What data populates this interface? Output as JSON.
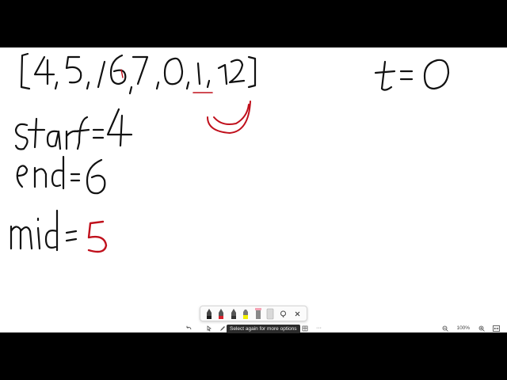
{
  "whiteboard": {
    "ink_colors": {
      "black": "#111111",
      "red": "#c0101c"
    },
    "handwriting": {
      "array": "[4,5,6,7,0,1,2]",
      "target": "t = 0",
      "start": "start = 4",
      "end": "end = 6",
      "mid": "mid = 5"
    }
  },
  "pen_toolbar": {
    "pens": [
      {
        "name": "black-pen",
        "color": "#1a1a1a"
      },
      {
        "name": "red-pen",
        "color": "#d8202c"
      },
      {
        "name": "dark-pen",
        "color": "#333333"
      },
      {
        "name": "highlighter-yellow",
        "color": "#f2f000"
      },
      {
        "name": "highlighter-pink",
        "color": "#f4a3b4"
      },
      {
        "name": "eraser",
        "color": "#d9d9d9"
      }
    ],
    "lasso_icon": "lasso-icon",
    "close_icon": "close-icon"
  },
  "bottom_bar": {
    "tooltip": "Select again for more options",
    "icons": [
      "undo-icon",
      "select-icon",
      "pen-icon",
      "table-icon",
      "more-icon"
    ],
    "more_label": "···"
  },
  "zoom": {
    "level": "100%",
    "zoom_out_icon": "zoom-out-icon",
    "zoom_in_icon": "zoom-in-icon",
    "fit_icon": "fit-screen-icon"
  }
}
